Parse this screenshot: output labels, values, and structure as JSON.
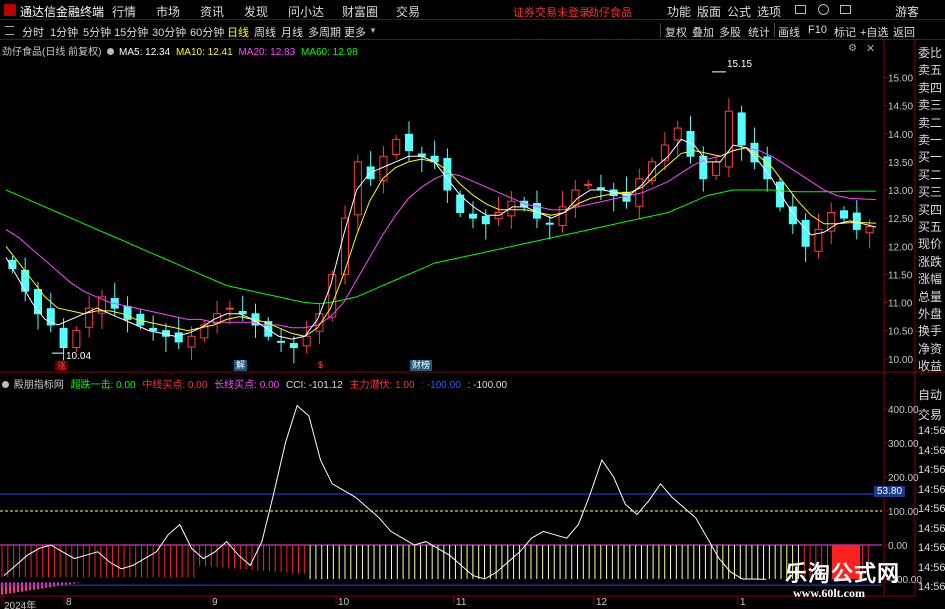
{
  "app": {
    "title": "通达信金融终端",
    "menu": [
      "行情",
      "市场",
      "资讯",
      "发现",
      "问小达",
      "财富圈",
      "交易"
    ],
    "notice": "证券交易未登录",
    "stock": "劲仔食品",
    "right_menu": [
      "功能",
      "版面",
      "公式",
      "选项"
    ],
    "guest": "游客",
    "accent": "#ff2a2a"
  },
  "periods": [
    "分时",
    "1分钟",
    "5分钟",
    "15分钟",
    "30分钟",
    "60分钟",
    "日线",
    "周线",
    "月线",
    "多周期",
    "更多"
  ],
  "active_period": "日线",
  "tools": [
    "复权",
    "叠加",
    "多股",
    "统计",
    "画线",
    "F10",
    "标记",
    "+自选",
    "返回"
  ],
  "chart_header": {
    "title": "劲仔食品(日线 前复权)",
    "ma": [
      {
        "label": "MA5: 12.34",
        "color": "#ffffff"
      },
      {
        "label": "MA10: 12.41",
        "color": "#ffff00"
      },
      {
        "label": "MA20: 12.83",
        "color": "#ff44ff"
      },
      {
        "label": "MA60: 12.98",
        "color": "#00ff00"
      }
    ]
  },
  "indicator_header": {
    "name": "殿朋指标网",
    "items": [
      {
        "label": "超跌一击: 0.00",
        "color": "#00ff00"
      },
      {
        "label": "中线买点: 0.00",
        "color": "#ff3030"
      },
      {
        "label": "长线买点: 0.00",
        "color": "#ff44ff"
      },
      {
        "label": "CCI: -101.12",
        "color": "#dcdcdc"
      },
      {
        "label": "主力潜伏: 1.00",
        "color": "#ff3030"
      },
      {
        "label": ": -100.00",
        "color": "#2a5cff"
      },
      {
        "label": ": -100.00",
        "color": "#dcdcdc"
      }
    ]
  },
  "side_panel": [
    "委比",
    "卖五",
    "卖四",
    "卖三",
    "卖二",
    "卖一",
    "买一",
    "买二",
    "买三",
    "买四",
    "买五",
    "现价",
    "涨跌",
    "涨幅",
    "总量",
    "外盘",
    "换手",
    "净资",
    "收益"
  ],
  "side_panel_lower": [
    "自动",
    "交易",
    "14:56",
    "14:56",
    "14:56",
    "14:56",
    "14:56",
    "14:56",
    "14:56",
    "14:56",
    "14:56"
  ],
  "dates": [
    "2024年",
    "8",
    "9",
    "10",
    "11",
    "12",
    "1"
  ],
  "events": [
    {
      "label": "涨",
      "color": "#ff4040",
      "bg": "#5a0000"
    },
    {
      "label": "解",
      "color": "#ffffff",
      "bg": "#205a80"
    },
    {
      "label": "$",
      "color": "#ff4040",
      "bg": "#000"
    },
    {
      "label": "财榜",
      "color": "#ffffff",
      "bg": "#205a80"
    }
  ],
  "annotations": {
    "high": "15.15",
    "low": "10.04",
    "cci_marker": "53.80"
  },
  "watermark": {
    "title": "乐淘公式网",
    "url": "www.60lt.com"
  },
  "chart_data": [
    {
      "type": "candlestick",
      "title": "劲仔食品(日线 前复权)",
      "ylim": [
        9.8,
        15.4
      ],
      "yticks": [
        10.0,
        10.5,
        11.0,
        11.5,
        12.0,
        12.5,
        13.0,
        13.5,
        14.0,
        14.5,
        15.0
      ],
      "x_labels": [
        "2024年",
        "8",
        "9",
        "10",
        "11",
        "12",
        "1"
      ],
      "high": 15.15,
      "low": 10.04,
      "ma": {
        "MA5": 12.34,
        "MA10": 12.41,
        "MA20": 12.83,
        "MA60": 12.98
      },
      "close_path": [
        11.6,
        11.2,
        10.8,
        10.6,
        10.2,
        10.5,
        10.9,
        11.1,
        10.9,
        10.7,
        10.6,
        10.5,
        10.4,
        10.3,
        10.4,
        10.6,
        10.8,
        10.9,
        10.8,
        10.6,
        10.4,
        10.3,
        10.2,
        10.4,
        10.8,
        11.5,
        12.5,
        13.5,
        13.2,
        13.6,
        13.9,
        13.7,
        13.6,
        13.5,
        13.0,
        12.6,
        12.5,
        12.4,
        12.6,
        12.8,
        12.7,
        12.5,
        12.4,
        12.7,
        13.0,
        13.1,
        13.0,
        12.9,
        12.8,
        13.2,
        13.5,
        13.8,
        14.1,
        13.6,
        13.2,
        13.5,
        14.4,
        13.8,
        13.5,
        13.2,
        12.7,
        12.4,
        12.0,
        12.3,
        12.6,
        12.5,
        12.3,
        12.35
      ],
      "ma5": [
        11.8,
        11.4,
        11.0,
        10.7,
        10.6,
        10.7,
        10.8,
        10.9,
        10.8,
        10.7,
        10.6,
        10.5,
        10.45,
        10.4,
        10.45,
        10.55,
        10.7,
        10.8,
        10.8,
        10.7,
        10.55,
        10.4,
        10.35,
        10.4,
        10.7,
        11.3,
        12.2,
        13.0,
        13.3,
        13.4,
        13.5,
        13.6,
        13.6,
        13.5,
        13.2,
        12.9,
        12.7,
        12.55,
        12.55,
        12.7,
        12.7,
        12.6,
        12.5,
        12.6,
        12.85,
        13.0,
        13.0,
        12.95,
        12.9,
        13.1,
        13.4,
        13.6,
        13.9,
        13.8,
        13.5,
        13.5,
        13.8,
        13.75,
        13.5,
        13.2,
        12.8,
        12.45,
        12.2,
        12.25,
        12.4,
        12.45,
        12.4,
        12.34
      ],
      "ma10": [
        12.0,
        11.7,
        11.4,
        11.1,
        10.9,
        10.85,
        10.8,
        10.85,
        10.85,
        10.8,
        10.7,
        10.65,
        10.6,
        10.55,
        10.5,
        10.55,
        10.6,
        10.7,
        10.75,
        10.7,
        10.65,
        10.55,
        10.45,
        10.4,
        10.55,
        10.9,
        11.5,
        12.2,
        12.8,
        13.2,
        13.4,
        13.5,
        13.55,
        13.5,
        13.35,
        13.1,
        12.9,
        12.75,
        12.65,
        12.65,
        12.65,
        12.6,
        12.55,
        12.6,
        12.75,
        12.85,
        12.9,
        12.95,
        12.95,
        13.05,
        13.25,
        13.45,
        13.65,
        13.7,
        13.65,
        13.6,
        13.7,
        13.75,
        13.6,
        13.4,
        13.1,
        12.8,
        12.55,
        12.4,
        12.4,
        12.42,
        12.42,
        12.41
      ],
      "ma20": [
        12.3,
        12.15,
        11.95,
        11.75,
        11.55,
        11.35,
        11.2,
        11.1,
        11.0,
        10.95,
        10.9,
        10.85,
        10.8,
        10.75,
        10.7,
        10.7,
        10.65,
        10.65,
        10.65,
        10.65,
        10.6,
        10.6,
        10.55,
        10.55,
        10.6,
        10.75,
        11.0,
        11.4,
        11.8,
        12.2,
        12.55,
        12.85,
        13.05,
        13.2,
        13.3,
        13.25,
        13.15,
        13.05,
        12.95,
        12.85,
        12.75,
        12.7,
        12.65,
        12.65,
        12.7,
        12.75,
        12.8,
        12.85,
        12.9,
        12.95,
        13.05,
        13.15,
        13.3,
        13.45,
        13.55,
        13.6,
        13.7,
        13.75,
        13.7,
        13.6,
        13.45,
        13.3,
        13.15,
        13.0,
        12.9,
        12.85,
        12.84,
        12.83
      ],
      "ma60": [
        13.0,
        12.9,
        12.8,
        12.7,
        12.6,
        12.5,
        12.4,
        12.3,
        12.2,
        12.1,
        12.0,
        11.9,
        11.8,
        11.7,
        11.6,
        11.5,
        11.4,
        11.3,
        11.25,
        11.2,
        11.15,
        11.1,
        11.05,
        11.0,
        10.98,
        11.0,
        11.05,
        11.1,
        11.2,
        11.3,
        11.4,
        11.5,
        11.6,
        11.7,
        11.75,
        11.8,
        11.85,
        11.9,
        11.95,
        12.0,
        12.05,
        12.1,
        12.15,
        12.2,
        12.25,
        12.3,
        12.35,
        12.4,
        12.45,
        12.5,
        12.55,
        12.6,
        12.7,
        12.8,
        12.9,
        12.95,
        13.0,
        13.0,
        13.0,
        13.0,
        12.98,
        12.97,
        12.97,
        12.97,
        12.97,
        12.98,
        12.98,
        12.98
      ]
    },
    {
      "type": "line",
      "title": "殿朋指标网",
      "ylim": [
        -150,
        450
      ],
      "yticks": [
        -100,
        0,
        100,
        200,
        300,
        400
      ],
      "series": [
        {
          "name": "CCI",
          "values": [
            -90,
            -60,
            -30,
            -10,
            0,
            -20,
            -40,
            -30,
            -20,
            -50,
            -70,
            -60,
            -40,
            -20,
            30,
            60,
            -10,
            -40,
            -20,
            10,
            -30,
            -60,
            10,
            150,
            300,
            410,
            380,
            250,
            180,
            160,
            140,
            110,
            80,
            40,
            20,
            0,
            10,
            -10,
            -30,
            -60,
            -90,
            -100,
            -80,
            -50,
            -20,
            20,
            40,
            30,
            20,
            60,
            150,
            250,
            200,
            120,
            90,
            130,
            180,
            140,
            110,
            80,
            20,
            -40,
            -80,
            -100,
            -100,
            -101.12
          ]
        }
      ],
      "reference_lines": [
        150,
        100,
        0
      ],
      "marker": 53.8
    }
  ]
}
